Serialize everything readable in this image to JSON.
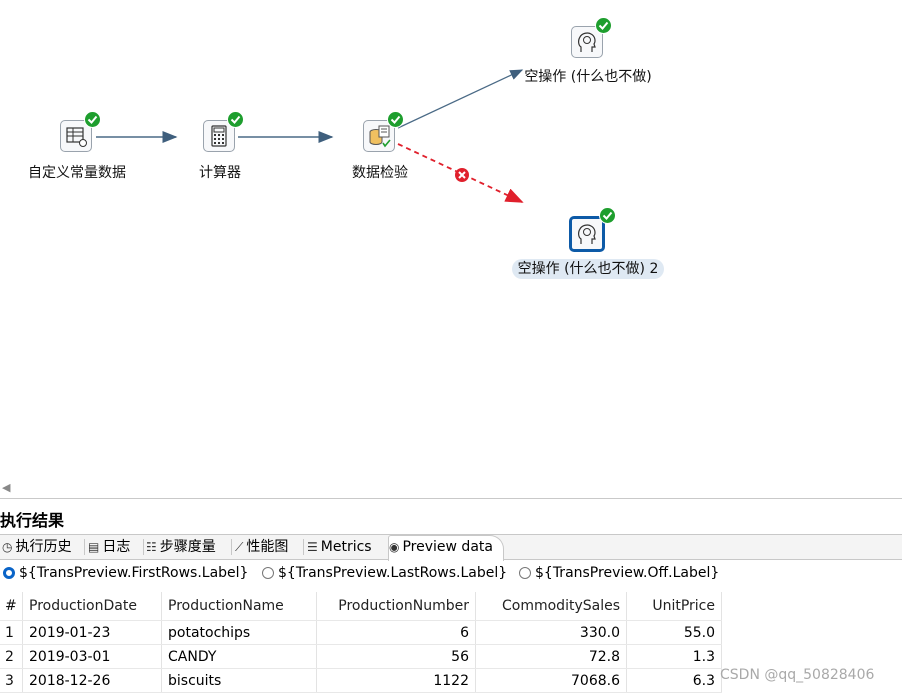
{
  "steps": {
    "s1": "自定义常量数据",
    "s2": "计算器",
    "s3": "数据检验",
    "s4": "空操作 (什么也不做)",
    "s5": "空操作 (什么也不做) 2"
  },
  "panel": {
    "title": "执行结果",
    "tabs": [
      "执行历史",
      "日志",
      "步骤度量",
      "性能图",
      "Metrics",
      "Preview data"
    ]
  },
  "preview": {
    "radios": [
      "${TransPreview.FirstRows.Label}",
      "${TransPreview.LastRows.Label}",
      "${TransPreview.Off.Label}"
    ],
    "selected_radio": 0,
    "columns": [
      "#",
      "ProductionDate",
      "ProductionName",
      "ProductionNumber",
      "CommoditySales",
      "UnitPrice"
    ],
    "rows": [
      [
        "1",
        "2019-01-23",
        "potatochips",
        "6",
        "330.0",
        "55.0"
      ],
      [
        "2",
        "2019-03-01",
        "CANDY",
        "56",
        "72.8",
        "1.3"
      ],
      [
        "3",
        "2018-12-26",
        "biscuits",
        "1122",
        "7068.6",
        "6.3"
      ]
    ]
  },
  "watermark": "CSDN @qq_50828406",
  "colors": {
    "ok": "#1e9e2e",
    "error": "#e0202c",
    "hop": "#4a6a86",
    "selected": "#0d5aa7"
  }
}
